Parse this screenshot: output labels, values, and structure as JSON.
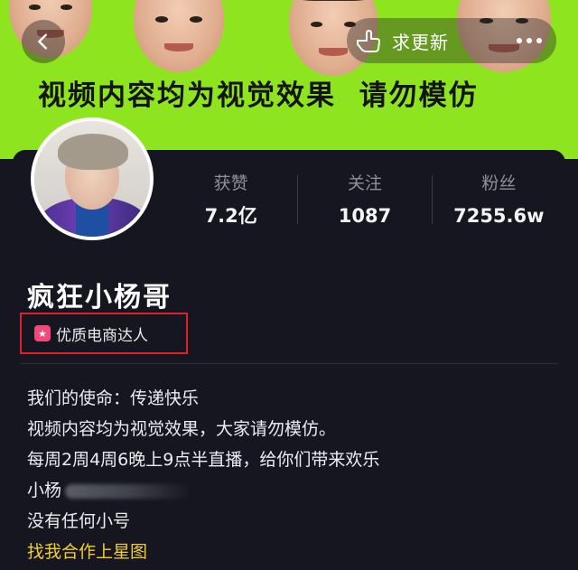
{
  "banner": {
    "text": "视频内容均为视觉效果  请勿模仿",
    "back_icon": "chevron-left-icon",
    "update_icon": "hand-point-icon",
    "update_label": "求更新",
    "more_icon": "more-horizontal-icon",
    "background_color": "#8ee51f"
  },
  "profile": {
    "avatar_alt": "avatar",
    "stats": [
      {
        "label": "获赞",
        "value": "7.2亿"
      },
      {
        "label": "关注",
        "value": "1087"
      },
      {
        "label": "粉丝",
        "value": "7255.6w"
      }
    ],
    "name": "疯狂小杨哥",
    "badge": {
      "icon": "star-badge-icon",
      "label": "优质电商达人",
      "highlight_color": "#e0202a"
    },
    "bio": [
      "我们的使命：传递快乐",
      "视频内容均为视觉效果，大家请勿模仿。",
      "每周2周4周6晚上9点半直播，给你们带来欢乐",
      "小杨",
      "没有任何小号"
    ],
    "link": "找我合作上星图",
    "link_color": "#f2cd33"
  }
}
